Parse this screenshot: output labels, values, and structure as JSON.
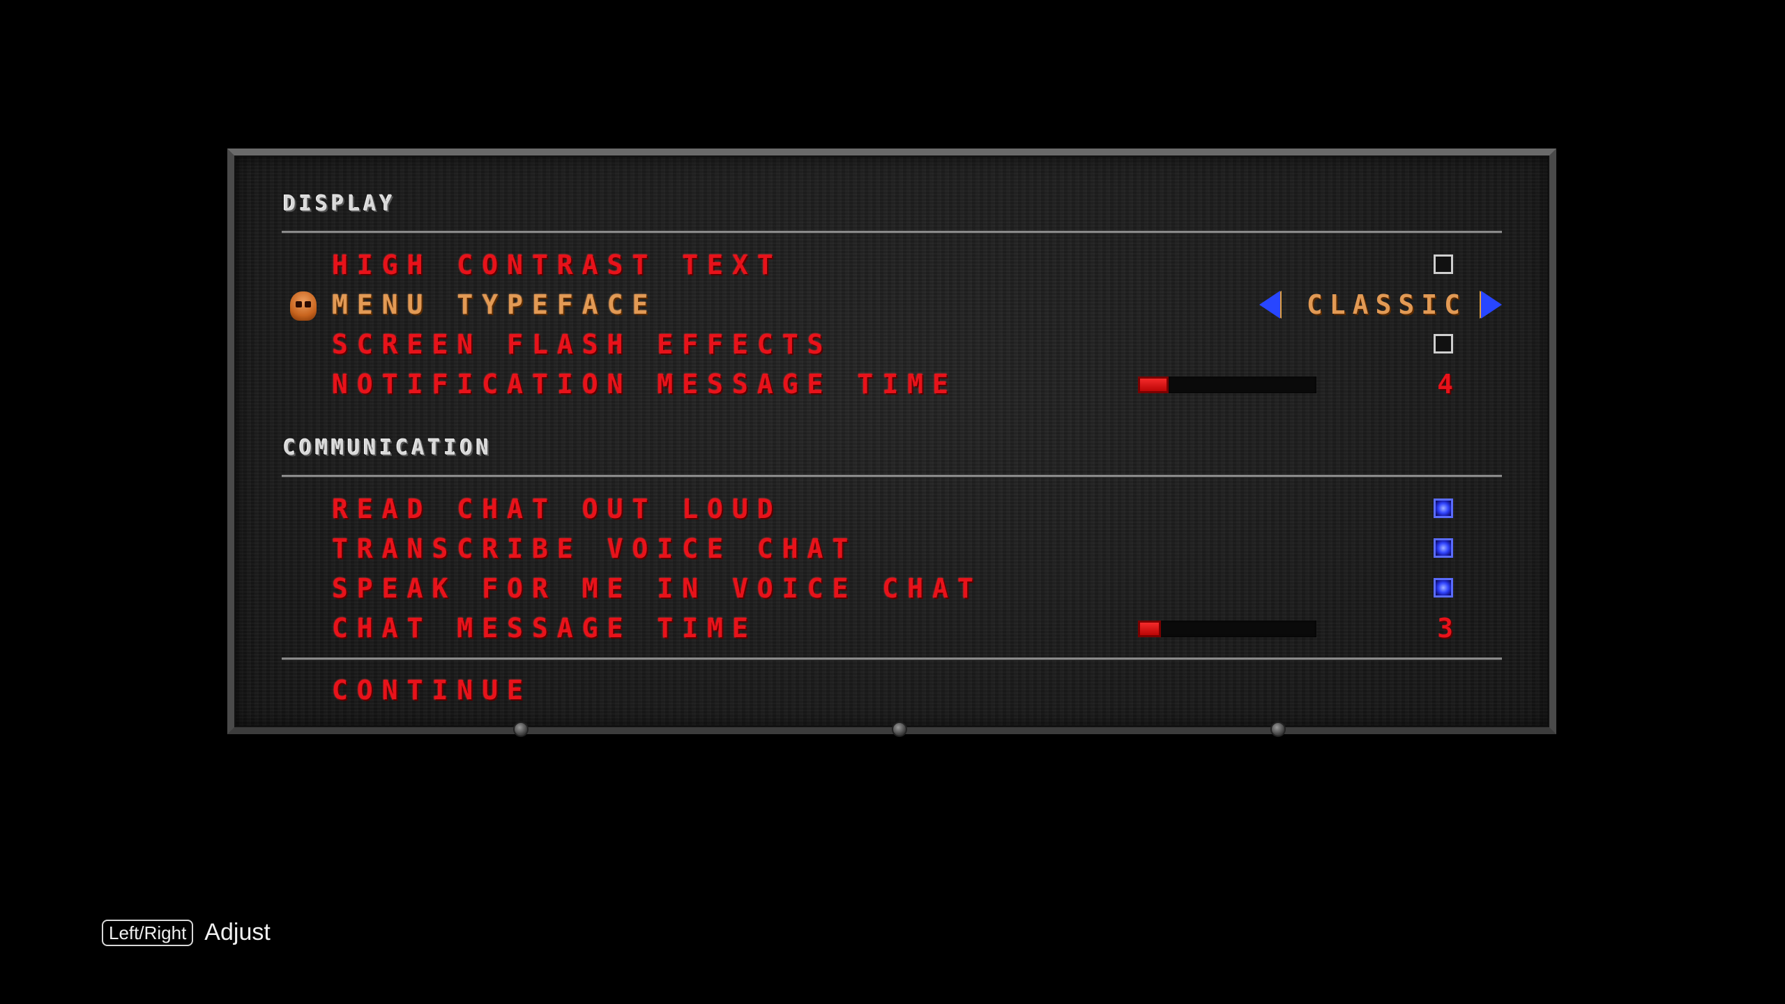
{
  "sections": {
    "display": {
      "header": "Display",
      "items": [
        {
          "label": "High Contrast Text",
          "control": "checkbox",
          "checked": false
        },
        {
          "label": "Menu Typeface",
          "control": "selector",
          "value": "Classic",
          "selected": true
        },
        {
          "label": "Screen Flash Effects",
          "control": "checkbox",
          "checked": false
        },
        {
          "label": "Notification Message Time",
          "control": "slider",
          "value": "4"
        }
      ]
    },
    "communication": {
      "header": "Communication",
      "items": [
        {
          "label": "Read Chat Out Loud",
          "control": "checkbox",
          "checked": true
        },
        {
          "label": "Transcribe Voice Chat",
          "control": "checkbox",
          "checked": true
        },
        {
          "label": "Speak For Me In Voice Chat",
          "control": "checkbox",
          "checked": true
        },
        {
          "label": "Chat Message Time",
          "control": "slider",
          "value": "3"
        }
      ]
    }
  },
  "continue_label": "Continue",
  "slider_levels": {
    "notification_fraction": 0.17,
    "chat_fraction": 0.13
  },
  "footer": {
    "key": "Left/Right",
    "action": "Adjust"
  },
  "colors": {
    "item_red": "#e8121a",
    "selected_orange": "#e29a55",
    "checkbox_blue": "#3246ff",
    "arrow_blue": "#2846ff"
  },
  "icons": {
    "cursor": "skull-icon",
    "selector_left": "arrow-left-icon",
    "selector_right": "arrow-right-icon"
  }
}
